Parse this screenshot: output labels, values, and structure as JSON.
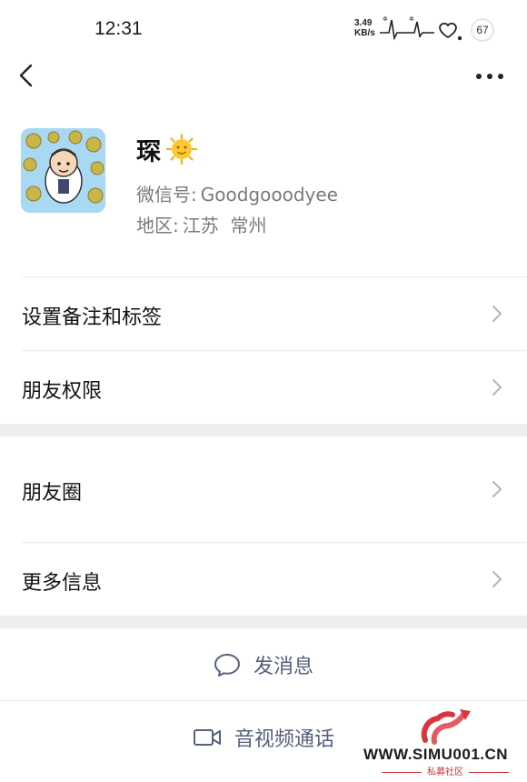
{
  "status_bar": {
    "time": "12:31",
    "net_speed_value": "3.49",
    "net_speed_unit": "KB/s",
    "battery": "67"
  },
  "nav": {
    "back_icon": "chevron-left-icon",
    "more_icon": "ellipsis-icon"
  },
  "profile": {
    "name": "琛",
    "name_emoji": "sun-with-face-icon",
    "wechat_id_label": "微信号:",
    "wechat_id": "Goodgooodyee",
    "region_label": "地区:",
    "region": "江苏  常州"
  },
  "list": {
    "remark_tags": "设置备注和标签",
    "friend_permissions": "朋友权限",
    "moments": "朋友圈",
    "more_info": "更多信息"
  },
  "actions": {
    "send_message": "发消息",
    "video_call": "音视频通话"
  },
  "watermark": {
    "site": "WWW.SIMU001.CN",
    "sub": "私募社区"
  },
  "colors": {
    "action_text": "#56607e",
    "gap": "#ededed",
    "watermark_red": "#c8333a"
  }
}
